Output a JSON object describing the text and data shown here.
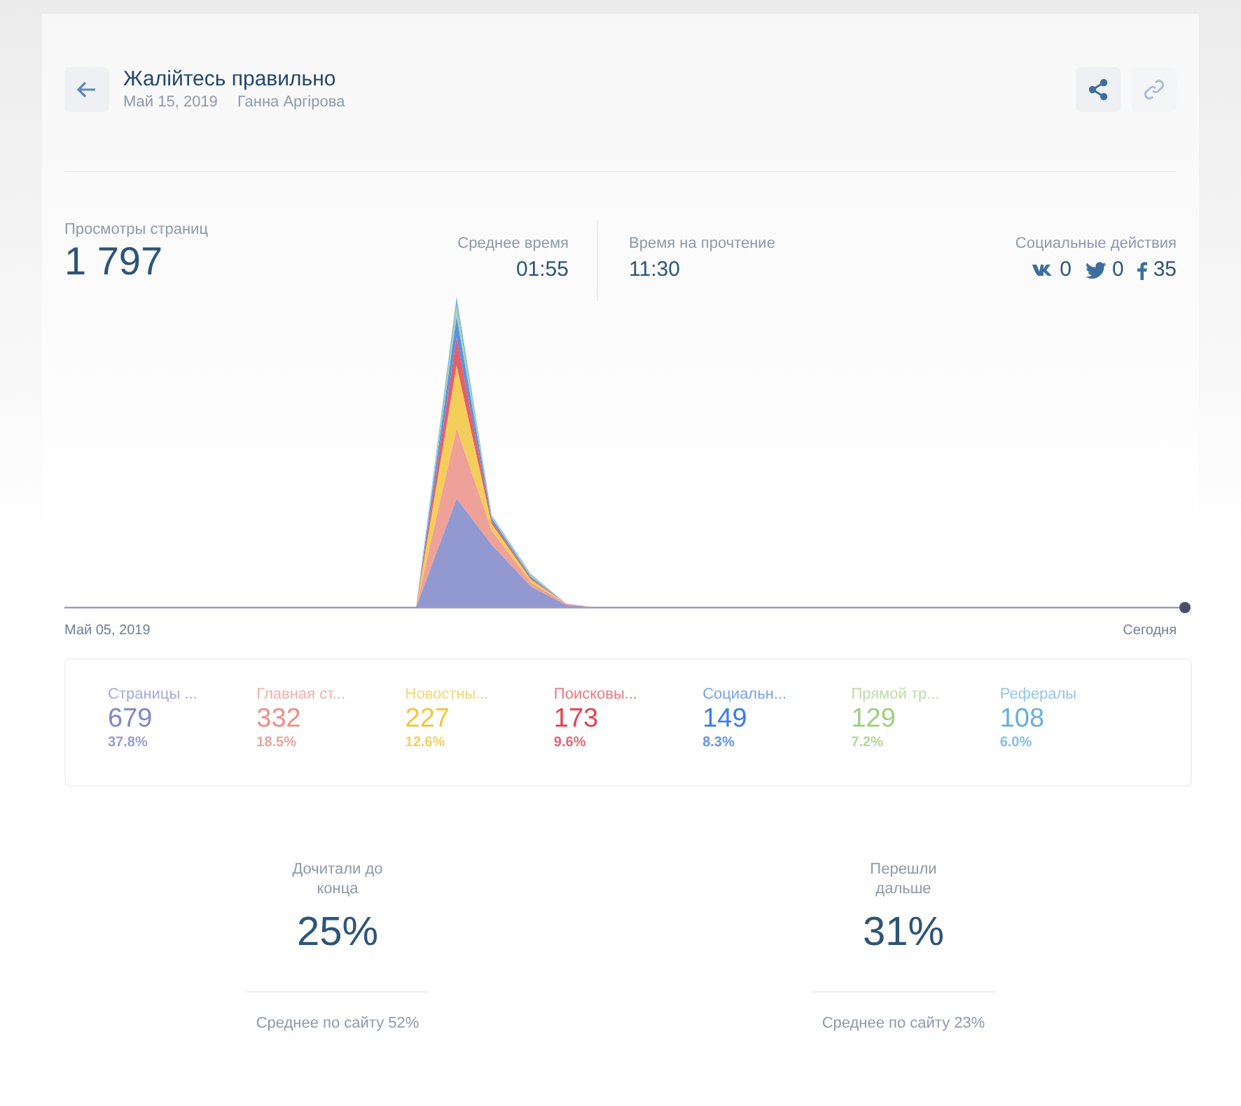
{
  "header": {
    "title": "Жалійтесь правильно",
    "date": "Май 15, 2019",
    "author": "Ганна Аргірова"
  },
  "stats": {
    "views": {
      "label": "Просмотры страниц",
      "value": "1 797"
    },
    "avg_time": {
      "label": "Среднее время",
      "value": "01:55"
    },
    "read_time": {
      "label": "Время на прочтение",
      "value": "11:30"
    },
    "social": {
      "label": "Социальные действия",
      "items": [
        {
          "kind": "vk",
          "count": "0"
        },
        {
          "kind": "twitter",
          "count": "0"
        },
        {
          "kind": "facebook",
          "count": "35"
        }
      ]
    }
  },
  "chart": {
    "start_label": "Май 05, 2019",
    "end_label": "Сегодня"
  },
  "sources": [
    {
      "label": "Страницы ...",
      "value": "679",
      "share": "37.8%",
      "color": "#7f87c9"
    },
    {
      "label": "Главная ст...",
      "value": "332",
      "share": "18.5%",
      "color": "#ec8f86"
    },
    {
      "label": "Новостны...",
      "value": "227",
      "share": "12.6%",
      "color": "#f2c53d"
    },
    {
      "label": "Поисковы...",
      "value": "173",
      "share": "9.6%",
      "color": "#e0434f"
    },
    {
      "label": "Социальн...",
      "value": "149",
      "share": "8.3%",
      "color": "#3d7ce0"
    },
    {
      "label": "Прямой тр...",
      "value": "129",
      "share": "7.2%",
      "color": "#9fcf7f"
    },
    {
      "label": "Рефералы",
      "value": "108",
      "share": "6.0%",
      "color": "#67aee0"
    }
  ],
  "reading": [
    {
      "label": "Дочитали до конца",
      "value": "25%",
      "average": "Среднее по сайту 52%"
    },
    {
      "label": "Перешли дальше",
      "value": "31%",
      "average": "Среднее по сайту 23%"
    }
  ]
}
